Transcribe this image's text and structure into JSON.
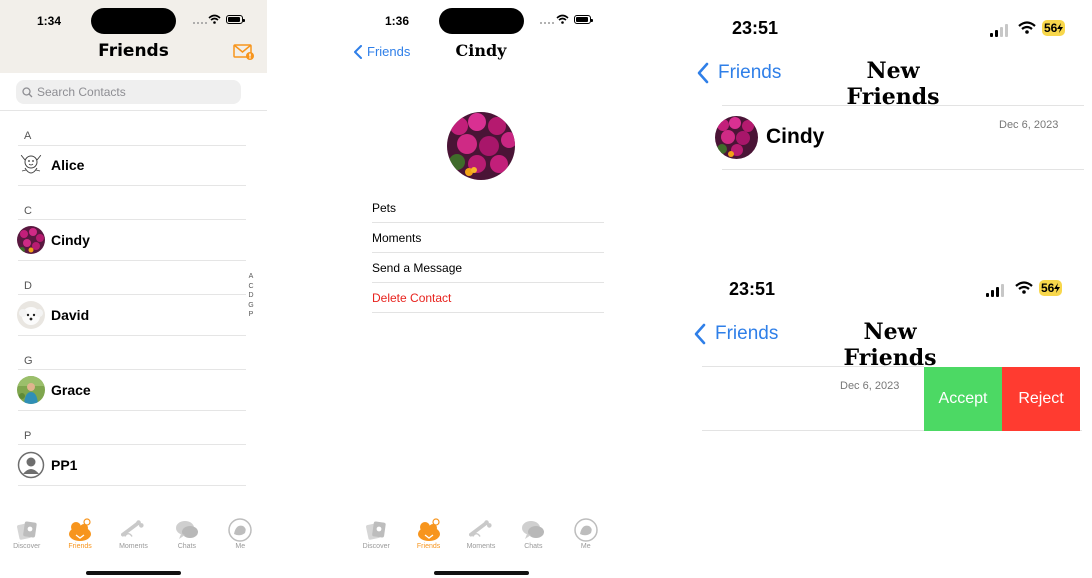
{
  "panel1": {
    "time": "1:34",
    "title": "Friends",
    "search_placeholder": "Search Contacts",
    "sections": [
      {
        "letter": "A",
        "name": "Alice"
      },
      {
        "letter": "C",
        "name": "Cindy"
      },
      {
        "letter": "D",
        "name": "David"
      },
      {
        "letter": "G",
        "name": "Grace"
      },
      {
        "letter": "P",
        "name": "PP1"
      }
    ],
    "index_letters": [
      "A",
      "C",
      "D",
      "G",
      "P"
    ],
    "tabs": [
      {
        "label": "Discover",
        "icon": "discover-icon"
      },
      {
        "label": "Friends",
        "icon": "friends-icon",
        "active": true
      },
      {
        "label": "Moments",
        "icon": "moments-icon"
      },
      {
        "label": "Chats",
        "icon": "chats-icon"
      },
      {
        "label": "Me",
        "icon": "me-icon"
      }
    ]
  },
  "panel2": {
    "time": "1:36",
    "back_label": "Friends",
    "title": "Cindy",
    "menu": [
      "Pets",
      "Moments",
      "Send a Message",
      "Delete Contact"
    ],
    "tabs": [
      "Discover",
      "Friends",
      "Moments",
      "Chats",
      "Me"
    ]
  },
  "panel3": {
    "time": "23:51",
    "battery": "56",
    "back_label": "Friends",
    "title": "New Friends",
    "request": {
      "name": "Cindy",
      "date": "Dec 6, 2023"
    }
  },
  "panel4": {
    "time": "23:51",
    "battery": "56",
    "back_label": "Friends",
    "title": "New Friends",
    "request": {
      "date": "Dec 6, 2023"
    },
    "accept_label": "Accept",
    "reject_label": "Reject"
  },
  "colors": {
    "accent": "#f7951d",
    "link": "#2f7fe8",
    "accept": "#4cd964",
    "reject": "#ff3b30",
    "danger": "#e8231e"
  }
}
